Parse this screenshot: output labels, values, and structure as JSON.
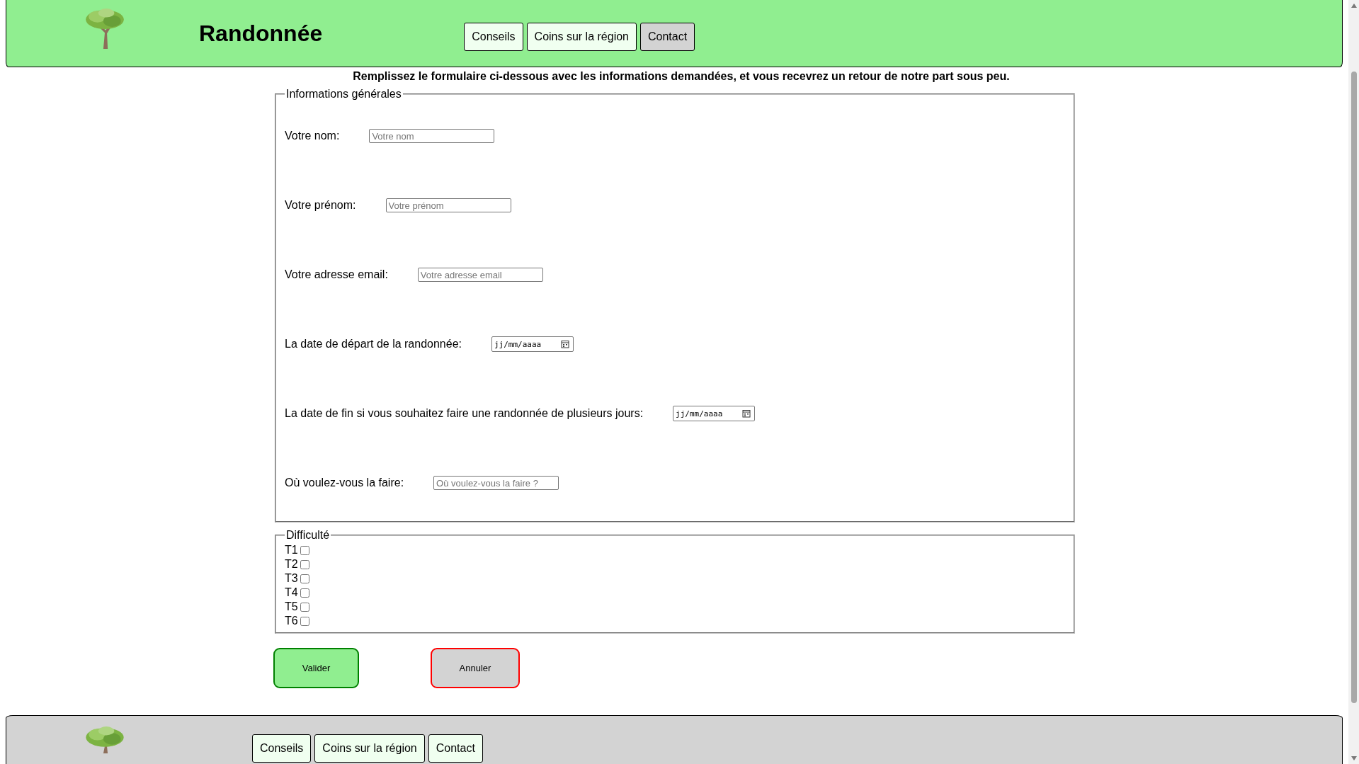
{
  "header": {
    "title": "Randonnée",
    "nav": [
      {
        "label": "Conseils",
        "selected": false
      },
      {
        "label": "Coins sur la région",
        "selected": false
      },
      {
        "label": "Contact",
        "selected": true
      }
    ]
  },
  "intro": "Remplissez le formulaire ci-dessous avec les informations demandées, et vous recevrez un retour de notre part sous peu.",
  "general": {
    "legend": "Informations générales",
    "fields": [
      {
        "kind": "text",
        "label": "Votre nom:",
        "placeholder": "Votre nom"
      },
      {
        "kind": "text",
        "label": "Votre prénom:",
        "placeholder": "Votre prénom"
      },
      {
        "kind": "text",
        "label": "Votre adresse email:",
        "placeholder": "Votre adresse email"
      },
      {
        "kind": "date",
        "label": "La date de départ de la randonnée:",
        "placeholder": "jj/mm/aaaa"
      },
      {
        "kind": "date",
        "label": "La date de fin si vous souhaitez faire une randonnée de plusieurs jours:",
        "placeholder": "jj/mm/aaaa"
      },
      {
        "kind": "text",
        "label": "Où voulez-vous la faire:",
        "placeholder": "Où voulez-vous la faire ?"
      }
    ]
  },
  "difficulty": {
    "legend": "Difficulté",
    "options": [
      {
        "label": "T1",
        "checked": false
      },
      {
        "label": "T2",
        "checked": false
      },
      {
        "label": "T3",
        "checked": false
      },
      {
        "label": "T4",
        "checked": false
      },
      {
        "label": "T5",
        "checked": false
      },
      {
        "label": "T6",
        "checked": false
      }
    ]
  },
  "actions": [
    {
      "kind": "submit",
      "label": "Valider"
    },
    {
      "kind": "cancel",
      "label": "Annuler"
    }
  ],
  "footer": {
    "nav": [
      {
        "label": "Conseils"
      },
      {
        "label": "Coins sur la région"
      },
      {
        "label": "Contact"
      }
    ]
  }
}
